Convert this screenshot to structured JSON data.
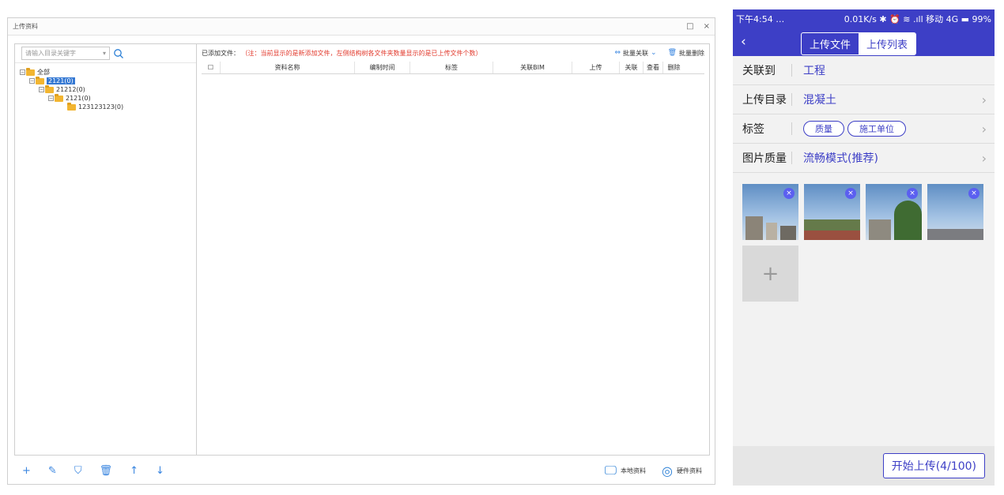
{
  "desktop": {
    "title": "上传资料",
    "window_buttons": {
      "maximize": "□",
      "close": "×"
    },
    "search": {
      "placeholder": "请输入目录关键字"
    },
    "tree": [
      {
        "label": "全部",
        "level": 0
      },
      {
        "label": "2121(0)",
        "level": 1,
        "selected": true
      },
      {
        "label": "21212(0)",
        "level": 2
      },
      {
        "label": "2121(0)",
        "level": 3
      },
      {
        "label": "123123123(0)",
        "level": 4
      }
    ],
    "added_label": "已添加文件：",
    "note": "（注：当前显示的是新添加文件，左侧结构树各文件夹数量显示的是已上传文件个数）",
    "batch_link_label": "批量关联",
    "batch_delete_label": "批量删除",
    "columns": [
      "资料名称",
      "编制时间",
      "标签",
      "关联BIM",
      "上传",
      "关联",
      "查看",
      "删除"
    ],
    "local_btn": "本地资料",
    "hardware_btn": "硬件资料"
  },
  "mobile": {
    "status": {
      "time": "下午4:54 …",
      "right": "0.01K/s ✱ ⏰ ≋ .ıll 移动 4G ▬ 99%"
    },
    "tabs": [
      "上传文件",
      "上传列表"
    ],
    "rows": [
      {
        "key": "关联到",
        "value": "工程"
      },
      {
        "key": "上传目录",
        "value": "混凝土"
      },
      {
        "key": "标签",
        "tags": [
          "质量",
          "施工单位"
        ]
      },
      {
        "key": "图片质量",
        "value": "流畅模式(推荐)"
      }
    ],
    "start_button": "开始上传(4/100)"
  }
}
